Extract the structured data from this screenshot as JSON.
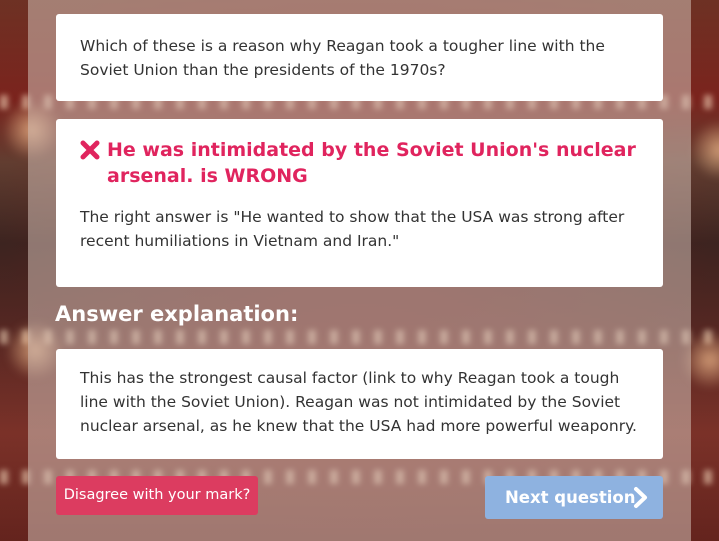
{
  "question": {
    "text": "Which of these is a reason why Reagan took a tougher line with the Soviet Union than the presidents of the 1970s?"
  },
  "result": {
    "status_icon": "cross-icon",
    "wrong_answer_title": "He was intimidated by the Soviet Union's nuclear arsenal. is WRONG",
    "right_answer_text": "The right answer is \"He wanted to show that the USA was strong after recent humiliations in Vietnam and Iran.\""
  },
  "explanation": {
    "heading": "Answer explanation:",
    "text": "This has the strongest causal factor (link to why Reagan took a tough line with the Soviet Union). Reagan was not intimidated by the Soviet nuclear arsenal, as he knew that the USA had more powerful weaponry."
  },
  "actions": {
    "disagree_label": "Disagree with your mark?",
    "next_label": "Next question",
    "next_icon": "chevron-right-icon"
  },
  "colors": {
    "wrong": "#e0245e",
    "disagree_button": "#dc3c60",
    "next_button": "#8eb2e0"
  }
}
